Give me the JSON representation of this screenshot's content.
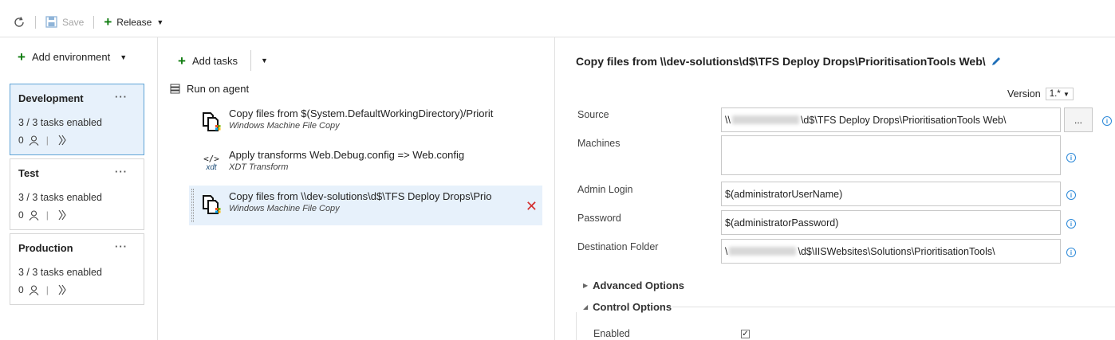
{
  "toolbar": {
    "refresh_icon": "refresh-icon",
    "save_label": "Save",
    "release_label": "Release"
  },
  "environments": {
    "add_label": "Add environment",
    "items": [
      {
        "name": "Development",
        "tasks": "3 / 3 tasks enabled",
        "approvals": "0"
      },
      {
        "name": "Test",
        "tasks": "3 / 3 tasks enabled",
        "approvals": "0"
      },
      {
        "name": "Production",
        "tasks": "3 / 3 tasks enabled",
        "approvals": "0"
      }
    ],
    "more": "···",
    "meta_sep": "|"
  },
  "tasks": {
    "add_label": "Add tasks",
    "run_on_agent": "Run on agent",
    "items": [
      {
        "title": "Copy files from $(System.DefaultWorkingDirectory)/Priorit",
        "subtitle": "Windows Machine File Copy"
      },
      {
        "title": "Apply transforms Web.Debug.config => Web.config",
        "subtitle": "XDT Transform",
        "icon_text": "xdt"
      },
      {
        "title": "Copy files from \\\\dev-solutions\\d$\\TFS Deploy Drops\\Prio",
        "subtitle": "Windows Machine File Copy"
      }
    ]
  },
  "detail": {
    "title": "Copy files from \\\\dev-solutions\\d$\\TFS Deploy Drops\\PrioritisationTools Web\\",
    "version_label": "Version",
    "version_value": "1.*",
    "fields": {
      "source_label": "Source",
      "source_prefix": "\\\\",
      "source_suffix": "\\d$\\TFS Deploy Drops\\PrioritisationTools Web\\",
      "browse_label": "...",
      "machines_label": "Machines",
      "machines_value": "",
      "admin_login_label": "Admin Login",
      "admin_login_value": "$(administratorUserName)",
      "password_label": "Password",
      "password_value": "$(administratorPassword)",
      "dest_label": "Destination Folder",
      "dest_prefix": "\\",
      "dest_suffix": "\\d$\\IISWebsites\\Solutions\\PrioritisationTools\\"
    },
    "advanced_options": "Advanced Options",
    "control_options": "Control Options",
    "enabled_label": "Enabled",
    "enabled_checked": true
  }
}
